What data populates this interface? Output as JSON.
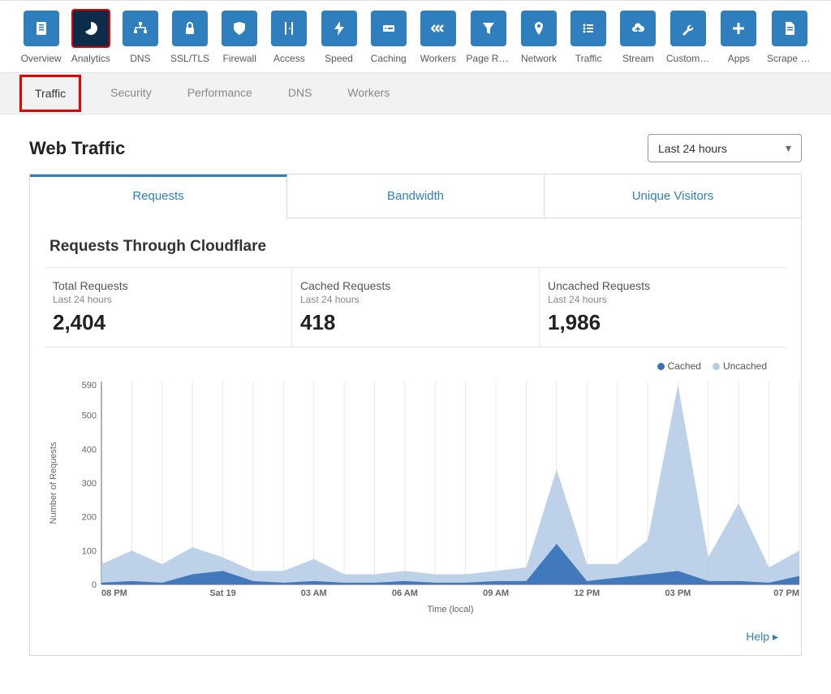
{
  "topnav": [
    {
      "label": "Overview",
      "icon": "clipboard",
      "active": false
    },
    {
      "label": "Analytics",
      "icon": "pie",
      "active": true
    },
    {
      "label": "DNS",
      "icon": "sitemap",
      "active": false
    },
    {
      "label": "SSL/TLS",
      "icon": "lock",
      "active": false
    },
    {
      "label": "Firewall",
      "icon": "shield",
      "active": false
    },
    {
      "label": "Access",
      "icon": "door",
      "active": false
    },
    {
      "label": "Speed",
      "icon": "bolt",
      "active": false
    },
    {
      "label": "Caching",
      "icon": "drive",
      "active": false
    },
    {
      "label": "Workers",
      "icon": "chevrons",
      "active": false
    },
    {
      "label": "Page Rules",
      "icon": "funnel",
      "active": false
    },
    {
      "label": "Network",
      "icon": "pin",
      "active": false
    },
    {
      "label": "Traffic",
      "icon": "list",
      "active": false
    },
    {
      "label": "Stream",
      "icon": "cloud",
      "active": false
    },
    {
      "label": "Custom Pa...",
      "icon": "wrench",
      "active": false
    },
    {
      "label": "Apps",
      "icon": "plus",
      "active": false
    },
    {
      "label": "Scrape Shi...",
      "icon": "doc",
      "active": false
    }
  ],
  "subnav": [
    {
      "label": "Traffic",
      "active": true
    },
    {
      "label": "Security",
      "active": false
    },
    {
      "label": "Performance",
      "active": false
    },
    {
      "label": "DNS",
      "active": false
    },
    {
      "label": "Workers",
      "active": false
    }
  ],
  "page_title": "Web Traffic",
  "time_select": "Last 24 hours",
  "tabs": [
    {
      "label": "Requests",
      "active": true
    },
    {
      "label": "Bandwidth",
      "active": false
    },
    {
      "label": "Unique Visitors",
      "active": false
    }
  ],
  "panel_title": "Requests Through Cloudflare",
  "stats": [
    {
      "label": "Total Requests",
      "sub": "Last 24 hours",
      "value": "2,404"
    },
    {
      "label": "Cached Requests",
      "sub": "Last 24 hours",
      "value": "418"
    },
    {
      "label": "Uncached Requests",
      "sub": "Last 24 hours",
      "value": "1,986"
    }
  ],
  "legend": [
    {
      "name": "Cached",
      "color": "#3b73b9"
    },
    {
      "name": "Uncached",
      "color": "#b6cce6"
    }
  ],
  "help_label": "Help",
  "chart_data": {
    "type": "area",
    "title": "",
    "xlabel": "Time (local)",
    "ylabel": "Number of Requests",
    "ylim": [
      0,
      600
    ],
    "y_ticks": [
      0,
      100,
      200,
      300,
      400,
      500,
      590
    ],
    "x_ticks": [
      "08 PM",
      "Sat 19",
      "03 AM",
      "06 AM",
      "09 AM",
      "12 PM",
      "03 PM",
      "07 PM"
    ],
    "x": [
      "08 PM",
      "09 PM",
      "10 PM",
      "11 PM",
      "Sat 19",
      "01 AM",
      "02 AM",
      "03 AM",
      "04 AM",
      "05 AM",
      "06 AM",
      "07 AM",
      "08 AM",
      "09 AM",
      "10 AM",
      "11 AM",
      "12 PM",
      "01 PM",
      "02 PM",
      "03 PM",
      "04 PM",
      "05 PM",
      "06 PM",
      "07 PM"
    ],
    "series": [
      {
        "name": "Uncached",
        "color": "#b6cce6",
        "values": [
          60,
          100,
          60,
          110,
          80,
          40,
          40,
          75,
          30,
          30,
          40,
          30,
          30,
          40,
          50,
          340,
          60,
          60,
          130,
          590,
          80,
          240,
          50,
          100
        ]
      },
      {
        "name": "Cached",
        "color": "#3b73b9",
        "values": [
          5,
          10,
          5,
          30,
          40,
          10,
          5,
          10,
          5,
          5,
          10,
          5,
          5,
          10,
          10,
          120,
          10,
          20,
          30,
          40,
          10,
          10,
          5,
          25
        ]
      }
    ]
  }
}
